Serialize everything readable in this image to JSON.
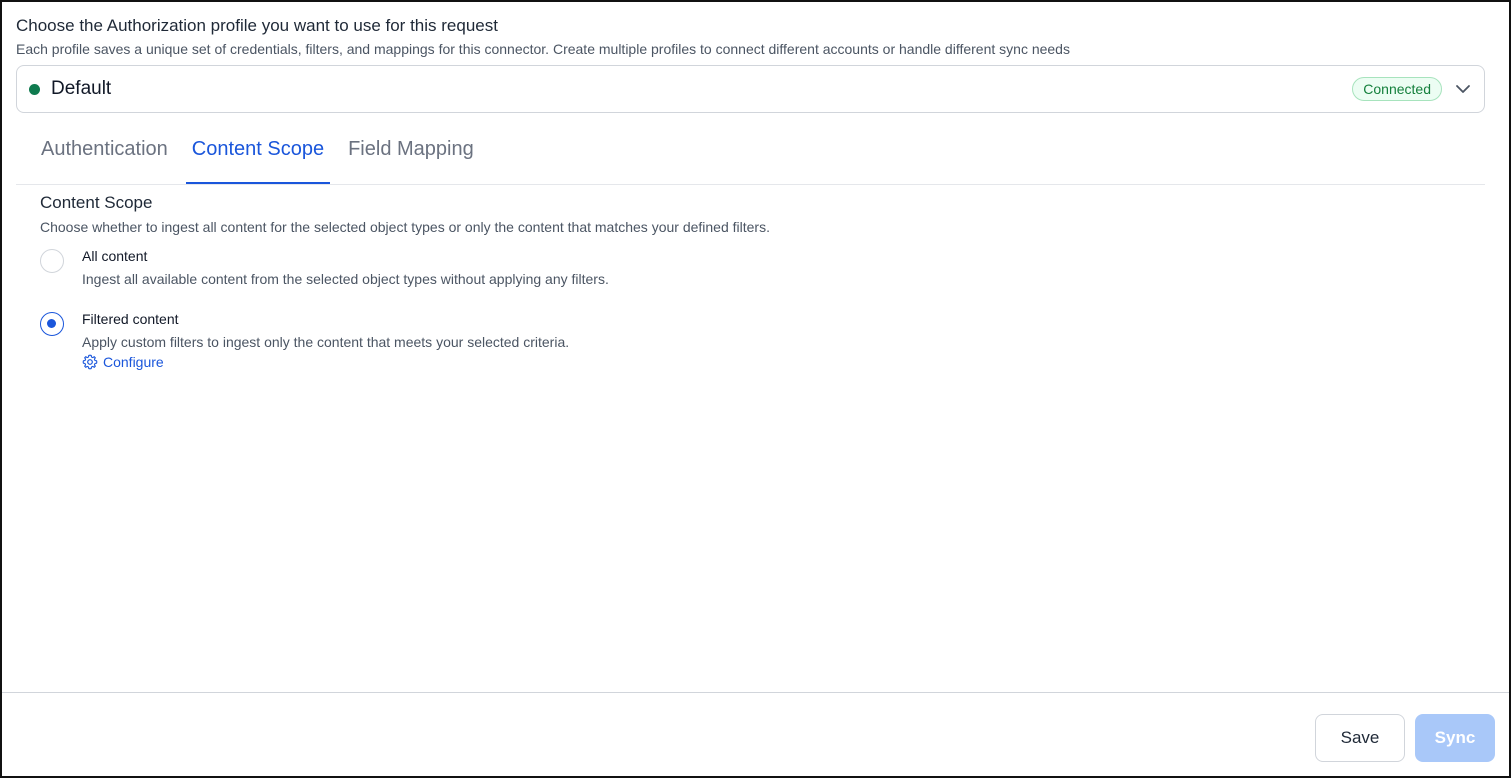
{
  "header": {
    "title": "Choose the Authorization profile you want to use for this request",
    "subtitle": "Each profile saves a unique set of credentials, filters, and mappings for this connector. Create multiple profiles to connect different accounts or handle different sync needs"
  },
  "profile": {
    "name": "Default",
    "status": "Connected",
    "status_color": "#0f7b4f"
  },
  "tabs": [
    {
      "label": "Authentication",
      "active": false
    },
    {
      "label": "Content Scope",
      "active": true
    },
    {
      "label": "Field Mapping",
      "active": false
    }
  ],
  "content_scope": {
    "title": "Content Scope",
    "description": "Choose whether to ingest all content for the selected object types or only the content that matches your defined filters.",
    "options": [
      {
        "label": "All content",
        "description": "Ingest all available content from the selected object types without applying any filters.",
        "selected": false
      },
      {
        "label": "Filtered content",
        "description": "Apply custom filters to ingest only the content that meets your selected criteria.",
        "selected": true,
        "link_label": "Configure"
      }
    ]
  },
  "footer": {
    "save_label": "Save",
    "sync_label": "Sync"
  },
  "colors": {
    "accent": "#1a56db",
    "sync_disabled": "#a9c8f9",
    "connected_bg": "#ecfdf3"
  }
}
